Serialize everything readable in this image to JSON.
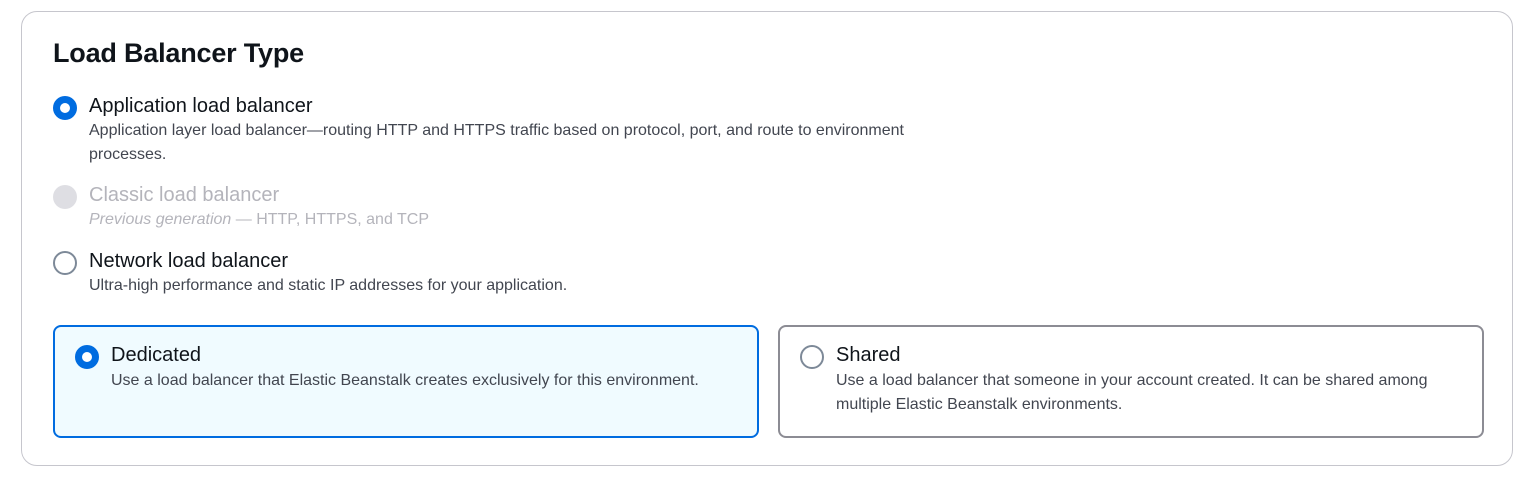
{
  "section": {
    "title": "Load Balancer Type"
  },
  "options": [
    {
      "label": "Application load balancer",
      "description": "Application layer load balancer—routing HTTP and HTTPS traffic based on protocol, port, and route to environment processes.",
      "state": "selected"
    },
    {
      "label": "Classic load balancer",
      "description_italic": "Previous generation",
      "description_rest": " — HTTP, HTTPS, and TCP",
      "state": "disabled"
    },
    {
      "label": "Network load balancer",
      "description": "Ultra-high performance and static IP addresses for your application.",
      "state": "unselected"
    }
  ],
  "cards": [
    {
      "label": "Dedicated",
      "description": "Use a load balancer that Elastic Beanstalk creates exclusively for this environment.",
      "state": "selected"
    },
    {
      "label": "Shared",
      "description": "Use a load balancer that someone in your account created. It can be shared among multiple Elastic Beanstalk environments.",
      "state": "unselected"
    }
  ],
  "colors": {
    "accent": "#006ce0",
    "selected_card_bg": "#f0fbff",
    "disabled": "#b4b4bb",
    "border": "#c6c6cd"
  }
}
